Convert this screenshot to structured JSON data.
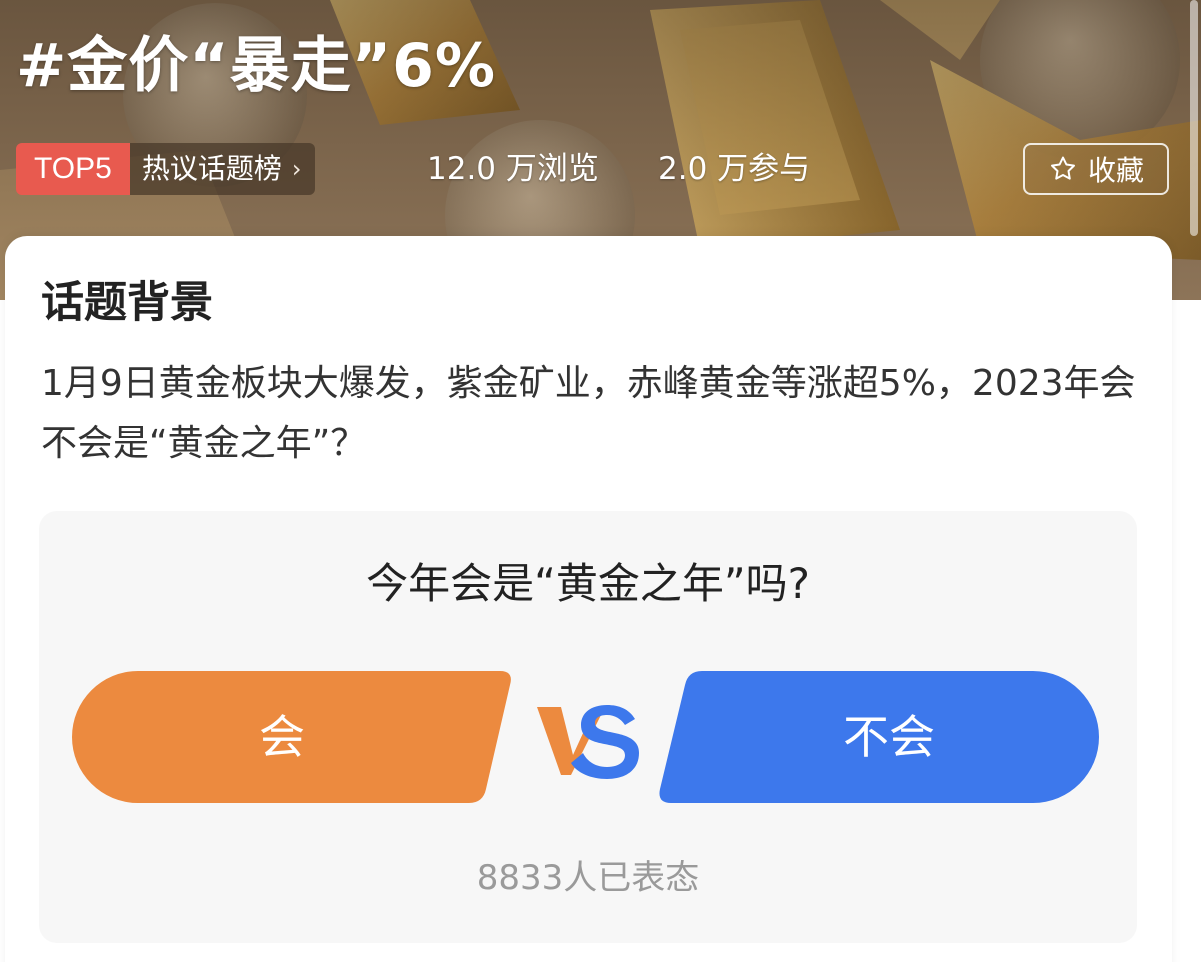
{
  "topic": {
    "title": "#金价“暴走”6%"
  },
  "rank": {
    "badge": "TOP5",
    "list_label": "热议话题榜",
    "chevron": "›"
  },
  "stats": {
    "views": "12.0 万浏览",
    "participants": "2.0 万参与"
  },
  "favorite": {
    "label": "收藏",
    "icon": "star-outline-icon"
  },
  "background_section": {
    "heading": "话题背景",
    "body": "1月9日黄金板块大爆发，紫金矿业，赤峰黄金等涨超5%，2023年会不会是“黄金之年”？"
  },
  "poll": {
    "question": "今年会是“黄金之年”吗?",
    "option_yes": "会",
    "option_no": "不会",
    "vs_mark": "VS",
    "vote_count": "8833人已表态"
  },
  "colors": {
    "badge_red": "#e85a4f",
    "yes_orange": "#ec8a3f",
    "no_blue": "#3d78ec"
  }
}
